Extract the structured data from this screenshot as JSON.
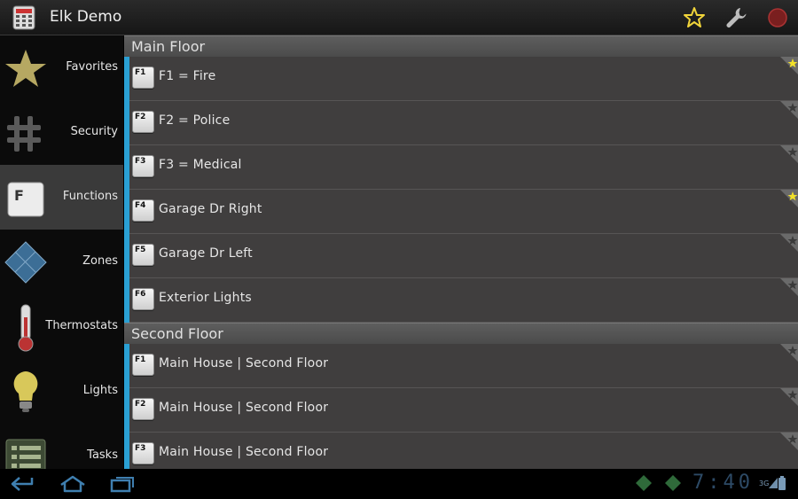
{
  "app": {
    "title": "Elk Demo"
  },
  "actionbar": {
    "favorites_icon": "star-outline-icon",
    "settings_icon": "wrench-icon",
    "close_icon": "red-circle-icon"
  },
  "sidebar": {
    "items": [
      {
        "label": "Favorites",
        "icon": "star-icon",
        "selected": false
      },
      {
        "label": "Security",
        "icon": "hash-icon",
        "selected": false
      },
      {
        "label": "Functions",
        "icon": "function-key-icon",
        "selected": true
      },
      {
        "label": "Zones",
        "icon": "zones-diamond-icon",
        "selected": false
      },
      {
        "label": "Thermostats",
        "icon": "thermometer-icon",
        "selected": false
      },
      {
        "label": "Lights",
        "icon": "lightbulb-icon",
        "selected": false
      },
      {
        "label": "Tasks",
        "icon": "tasks-list-icon",
        "selected": false
      }
    ]
  },
  "sections": [
    {
      "title": "Main Floor",
      "rows": [
        {
          "key": "F1",
          "label": "F1 = Fire",
          "favorite": true
        },
        {
          "key": "F2",
          "label": "F2 = Police",
          "favorite": false
        },
        {
          "key": "F3",
          "label": "F3 = Medical",
          "favorite": false
        },
        {
          "key": "F4",
          "label": "Garage Dr Right",
          "favorite": true
        },
        {
          "key": "F5",
          "label": "Garage Dr Left",
          "favorite": false
        },
        {
          "key": "F6",
          "label": "Exterior Lights",
          "favorite": false
        }
      ]
    },
    {
      "title": "Second Floor",
      "rows": [
        {
          "key": "F1",
          "label": "Main House | Second Floor",
          "favorite": false
        },
        {
          "key": "F2",
          "label": "Main House | Second Floor",
          "favorite": false
        },
        {
          "key": "F3",
          "label": "Main House | Second Floor",
          "favorite": false
        }
      ]
    }
  ],
  "sysbar": {
    "clock": "7:40",
    "network": "3G"
  },
  "colors": {
    "accent": "#2aa0d4",
    "favorite_on": "#f2e12a",
    "favorite_off": "#9a9a9a"
  }
}
